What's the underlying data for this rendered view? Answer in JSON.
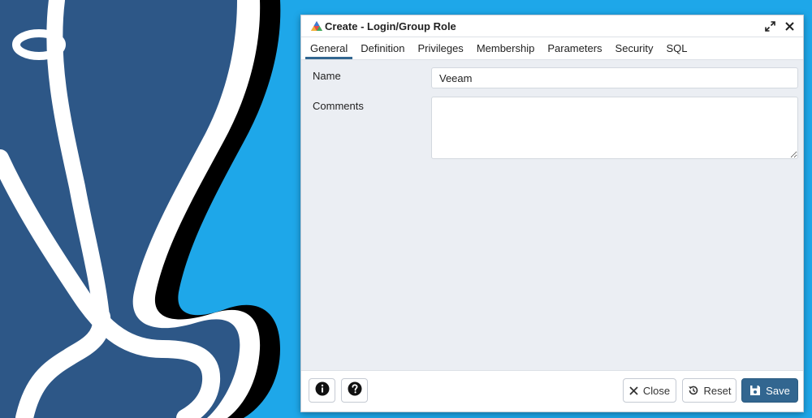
{
  "dialog": {
    "title": "Create - Login/Group Role",
    "icons": {
      "title": "role-group-icon",
      "maximize": "expand-arrows-icon",
      "close": "close-x-icon"
    }
  },
  "tabs": [
    {
      "label": "General",
      "active": true
    },
    {
      "label": "Definition",
      "active": false
    },
    {
      "label": "Privileges",
      "active": false
    },
    {
      "label": "Membership",
      "active": false
    },
    {
      "label": "Parameters",
      "active": false
    },
    {
      "label": "Security",
      "active": false
    },
    {
      "label": "SQL",
      "active": false
    }
  ],
  "form": {
    "name_label": "Name",
    "name_value": "Veeam",
    "comments_label": "Comments",
    "comments_value": ""
  },
  "footer": {
    "info_icon": "info-circle-icon",
    "help_icon": "question-circle-icon",
    "close_label": "Close",
    "reset_label": "Reset",
    "save_label": "Save"
  },
  "colors": {
    "background": "#1ea7e9",
    "accent": "#326690",
    "panel": "#ebeef3",
    "elephant_dark": "#2d5787"
  }
}
